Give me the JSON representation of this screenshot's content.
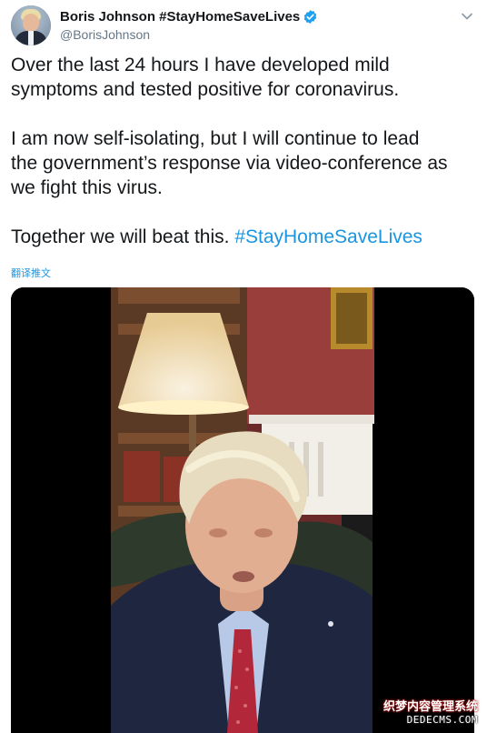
{
  "tweet": {
    "author": {
      "display_name": "Boris Johnson #StayHomeSaveLives",
      "handle": "@BorisJohnson",
      "verified": true,
      "avatar_icon": "profile-photo"
    },
    "menu_icon": "chevron-down-icon",
    "paragraphs": [
      "Over the last 24 hours I have developed mild",
      "symptoms and tested positive for coronavirus.",
      "I am now self-isolating, but I will continue to lead",
      "the government’s response via video-conference as",
      "we fight this virus."
    ],
    "closing_text": "Together we will beat this.",
    "closing_hashtag": "#StayHomeSaveLives",
    "translate_label": "翻译推文",
    "media": {
      "type": "video"
    }
  },
  "watermark": {
    "text": "织梦内容管理系统",
    "url": "DEDECMS.COM"
  },
  "colors": {
    "link": "#1b95e0",
    "text": "#14171a",
    "secondary": "#657786",
    "verified": "#1da1f2"
  }
}
